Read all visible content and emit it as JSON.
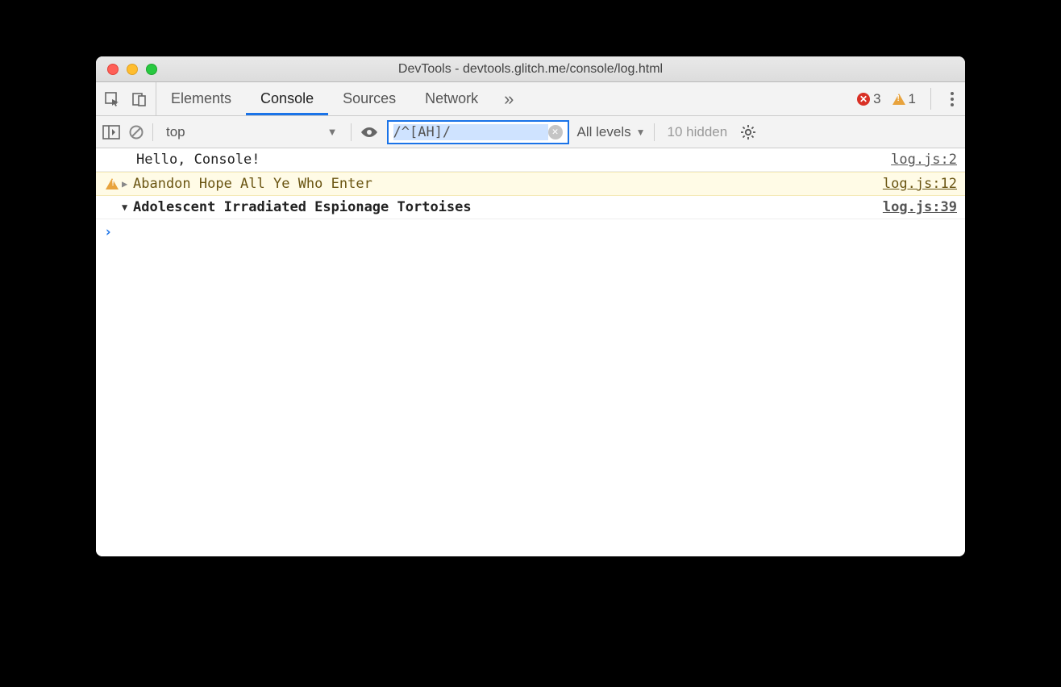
{
  "window": {
    "title": "DevTools - devtools.glitch.me/console/log.html"
  },
  "tabs": {
    "items": [
      "Elements",
      "Console",
      "Sources",
      "Network"
    ],
    "active": "Console",
    "more_glyph": "»"
  },
  "status": {
    "error_count": "3",
    "warning_count": "1"
  },
  "toolbar": {
    "context": "top",
    "filter_value": "/^[AH]/",
    "levels_label": "All levels",
    "hidden_label": "10 hidden"
  },
  "console": {
    "rows": [
      {
        "type": "log",
        "message": "Hello, Console!",
        "source": "log.js:2"
      },
      {
        "type": "warn",
        "message": "Abandon Hope All Ye Who Enter",
        "source": "log.js:12",
        "disclosure": "▶"
      },
      {
        "type": "group",
        "message": "Adolescent Irradiated Espionage Tortoises",
        "source": "log.js:39",
        "disclosure": "▼"
      }
    ],
    "prompt": "›"
  }
}
